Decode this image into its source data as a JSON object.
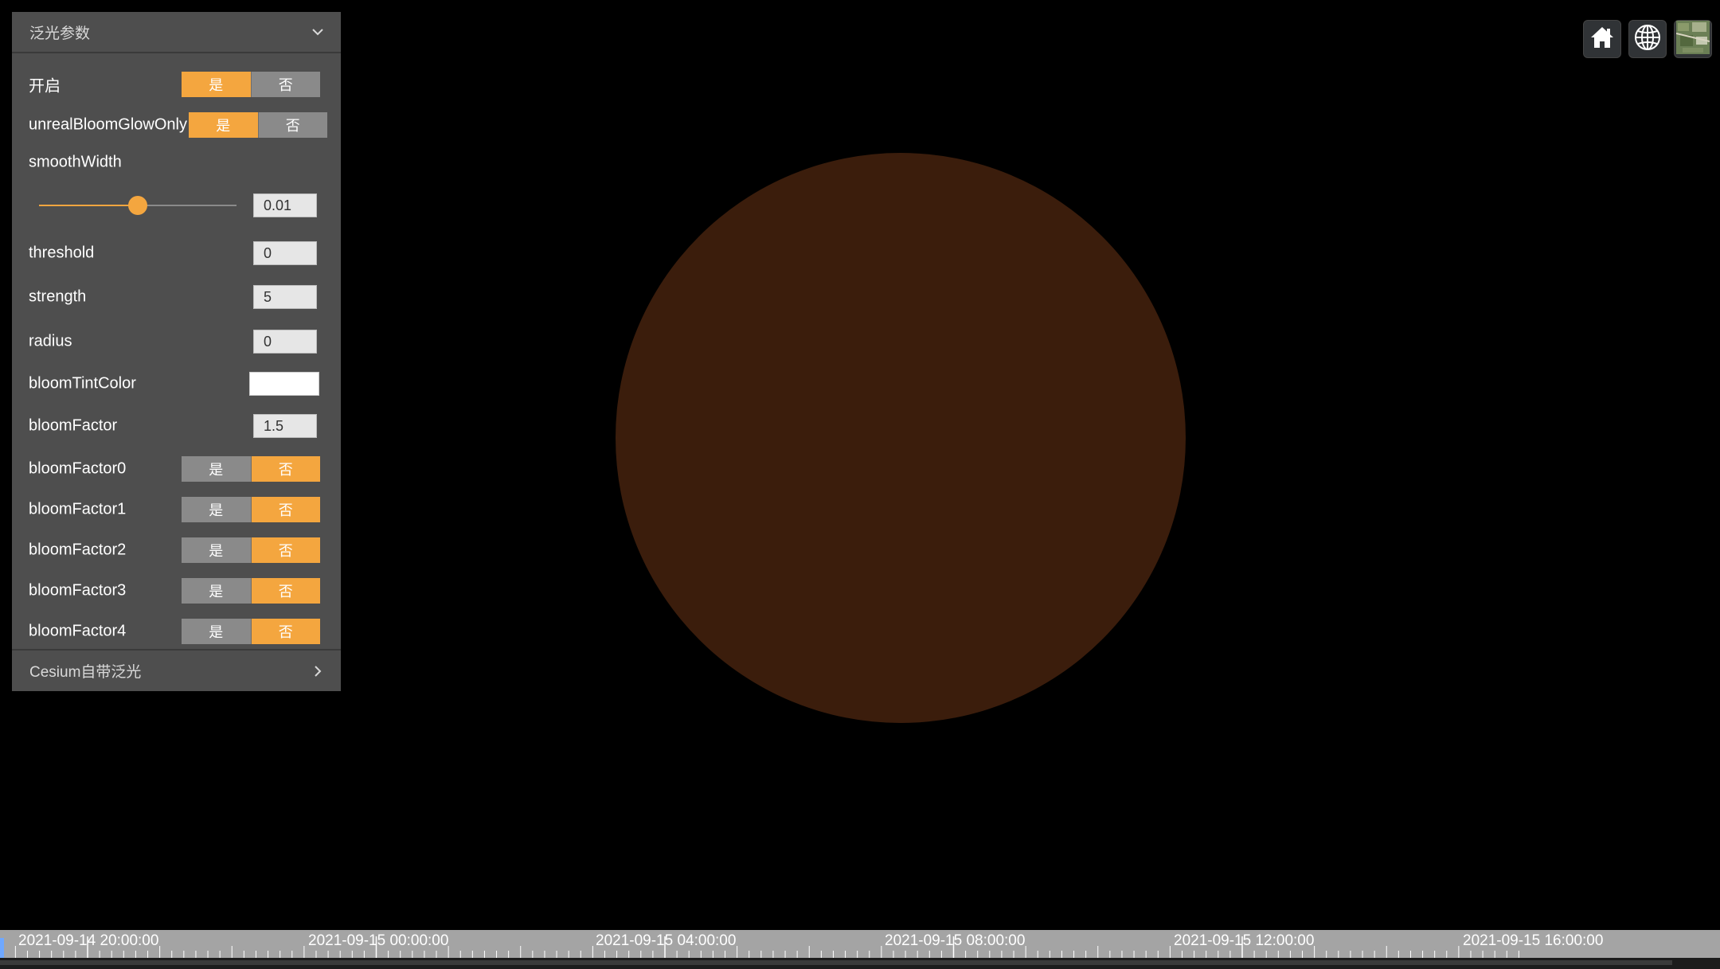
{
  "panel": {
    "title": "泛光参数",
    "yes_label": "是",
    "no_label": "否",
    "enable": {
      "label": "开启",
      "value": true
    },
    "glow_only": {
      "label": "unrealBloomGlowOnly",
      "value": true
    },
    "smooth_width": {
      "label": "smoothWidth",
      "value": "0.01",
      "slider_fraction": 0.5
    },
    "threshold": {
      "label": "threshold",
      "value": "0"
    },
    "strength": {
      "label": "strength",
      "value": "5"
    },
    "radius": {
      "label": "radius",
      "value": "0"
    },
    "tint_color": {
      "label": "bloomTintColor",
      "value": "#ffffff"
    },
    "bloom_factor": {
      "label": "bloomFactor",
      "value": "1.5"
    },
    "factors": [
      {
        "label": "bloomFactor0",
        "value": false
      },
      {
        "label": "bloomFactor1",
        "value": false
      },
      {
        "label": "bloomFactor2",
        "value": false
      },
      {
        "label": "bloomFactor3",
        "value": false
      },
      {
        "label": "bloomFactor4",
        "value": false
      }
    ],
    "section2_title": "Cesium自带泛光"
  },
  "toolbar": {
    "home_icon": "home-icon",
    "globe_icon": "globe-icon",
    "imagery_icon": "imagery-icon"
  },
  "colors": {
    "accent": "#f4a63f",
    "globe": "#3b1d0c",
    "panel_bg": "#4e4e4e"
  },
  "timeline": {
    "labels": [
      "2021-09-14 20:00:00",
      "2021-09-15 00:00:00",
      "2021-09-15 04:00:00",
      "2021-09-15 08:00:00",
      "2021-09-15 12:00:00",
      "2021-09-15 16:00:00"
    ]
  }
}
